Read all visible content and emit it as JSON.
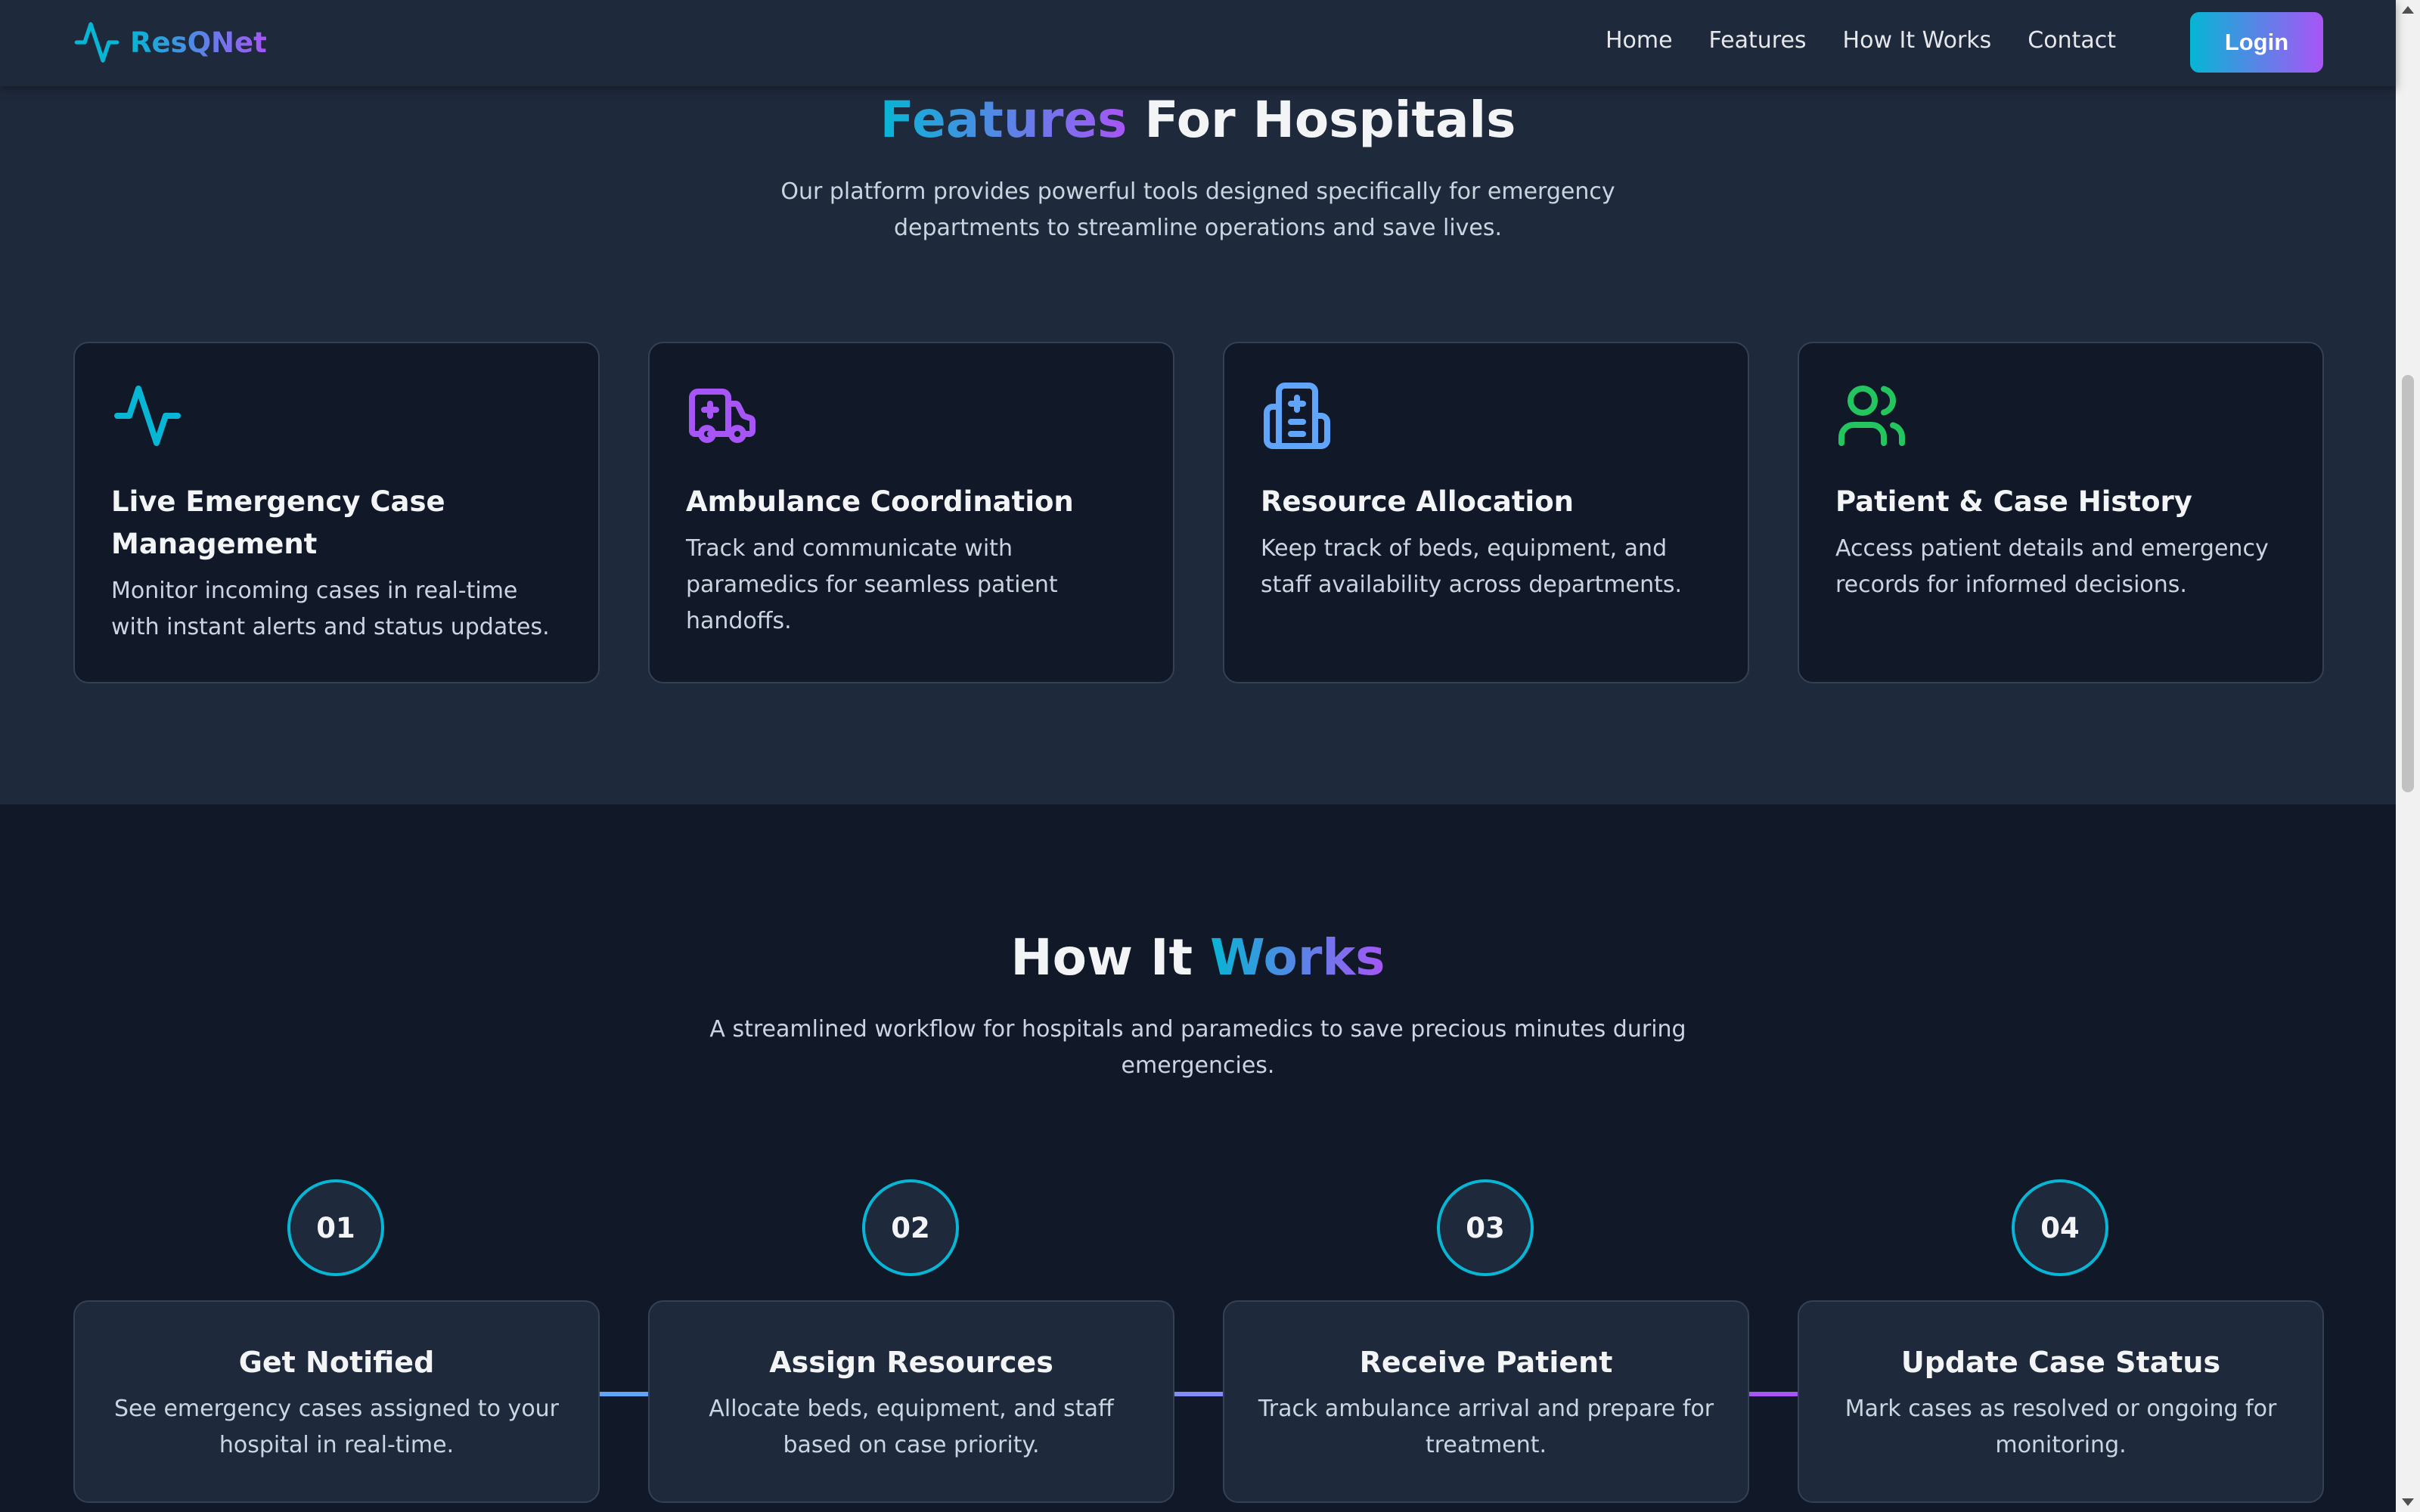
{
  "nav": {
    "brand": "ResQNet",
    "links": [
      "Home",
      "Features",
      "How It Works",
      "Contact"
    ],
    "login_label": "Login"
  },
  "features": {
    "title_highlight": "Features",
    "title_rest": " For Hospitals",
    "subtitle": "Our platform provides powerful tools designed specifically for emergency departments to streamline operations and save lives.",
    "cards": [
      {
        "icon": "activity-icon",
        "color": "#06b6d4",
        "title": "Live Emergency Case Management",
        "desc": "Monitor incoming cases in real-time with instant alerts and status updates."
      },
      {
        "icon": "ambulance-icon",
        "color": "#a855f7",
        "title": "Ambulance Coordination",
        "desc": "Track and communicate with paramedics for seamless patient handoffs."
      },
      {
        "icon": "hospital-icon",
        "color": "#60a5fa",
        "title": "Resource Allocation",
        "desc": "Keep track of beds, equipment, and staff availability across departments."
      },
      {
        "icon": "users-icon",
        "color": "#22c55e",
        "title": "Patient & Case History",
        "desc": "Access patient details and emergency records for informed decisions."
      }
    ]
  },
  "how": {
    "title_rest": "How It ",
    "title_highlight": "Works",
    "subtitle": "A streamlined workflow for hospitals and paramedics to save precious minutes during emergencies.",
    "steps": [
      {
        "num": "01",
        "title": "Get Notified",
        "desc": "See emergency cases assigned to your hospital in real-time."
      },
      {
        "num": "02",
        "title": "Assign Resources",
        "desc": "Allocate beds, equipment, and staff based on case priority."
      },
      {
        "num": "03",
        "title": "Receive Patient",
        "desc": "Track ambulance arrival and prepare for treatment."
      },
      {
        "num": "04",
        "title": "Update Case Status",
        "desc": "Mark cases as resolved or ongoing for monitoring."
      }
    ]
  },
  "colors": {
    "accent_start": "#06b6d4",
    "accent_end": "#a855f7",
    "bg_dark": "#111827",
    "bg_section": "#1e293b"
  }
}
